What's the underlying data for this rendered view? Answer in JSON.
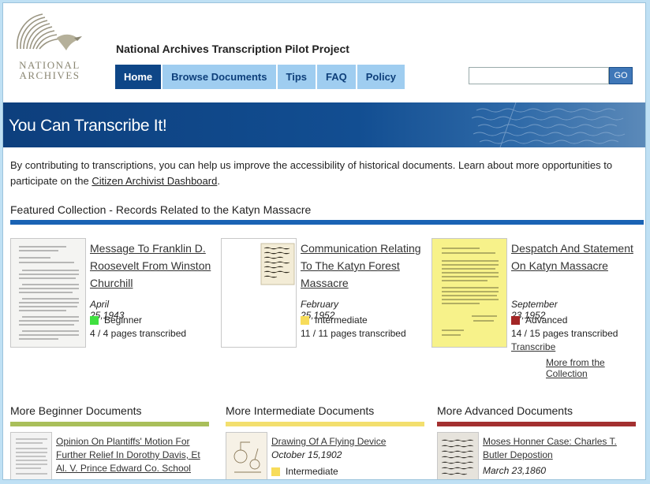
{
  "header": {
    "logo_lines": [
      "NATIONAL",
      "ARCHIVES"
    ],
    "site_title": "National Archives Transcription Pilot Project",
    "nav": [
      {
        "label": "Home",
        "active": true
      },
      {
        "label": "Browse Documents",
        "active": false
      },
      {
        "label": "Tips",
        "active": false
      },
      {
        "label": "FAQ",
        "active": false
      },
      {
        "label": "Policy",
        "active": false
      }
    ],
    "search": {
      "value": "",
      "placeholder": "",
      "button_label": "GO"
    }
  },
  "banner": {
    "title": "You Can Transcribe It!"
  },
  "intro": {
    "text_before_link": "By contributing to transcriptions, you can help us improve the accessibility of historical documents. Learn about more opportunities to participate on the ",
    "link_label": "Citizen Archivist Dashboard",
    "text_after_link": "."
  },
  "featured": {
    "heading": "Featured Collection - Records Related to the Katyn Massacre",
    "cards": [
      {
        "title": "Message To Franklin D. Roosevelt From Winston Churchill",
        "date": "April 25,1943",
        "level": "Beginner",
        "pages": "4 / 4 pages transcribed",
        "link": ""
      },
      {
        "title": "Communication Relating To The Katyn Forest Massacre",
        "date": "February 25,1952",
        "level": "Intermediate",
        "pages": "11 / 11 pages transcribed",
        "link": ""
      },
      {
        "title": "Despatch And Statement On Katyn Massacre",
        "date": "September 23,1952",
        "level": "Advanced",
        "pages": "14 / 15 pages transcribed",
        "link": "Transcribe"
      }
    ],
    "more_link": "More from the Collection"
  },
  "columns": [
    {
      "heading": "More Beginner Documents",
      "doc_title": "Opinion On Plantiffs' Motion For Further Relief In Dorothy Davis, Et Al. V. Prince Edward Co. School",
      "date": "",
      "level": ""
    },
    {
      "heading": "More Intermediate Documents",
      "doc_title": "Drawing Of A Flying Device",
      "date": "October 15,1902",
      "level": "Intermediate"
    },
    {
      "heading": "More Advanced Documents",
      "doc_title": "Moses Honner Case: Charles T. Butler Depostion",
      "date": "March 23,1860",
      "level": ""
    }
  ],
  "colors": {
    "nav_active": "#0e4687",
    "nav_inactive": "#9fcdf0",
    "banner": "#0d3f7d",
    "section_bar": "#1a63b4",
    "beginner": "#3fe03f",
    "intermediate": "#f7dc5a",
    "advanced": "#a32626",
    "beginner_bar": "#a9bf5a",
    "intermediate_bar": "#f3df6e",
    "advanced_bar": "#a33030"
  },
  "icons": [
    "eagle-logo-icon",
    "handwriting-banner-image",
    "document-thumbnail"
  ]
}
